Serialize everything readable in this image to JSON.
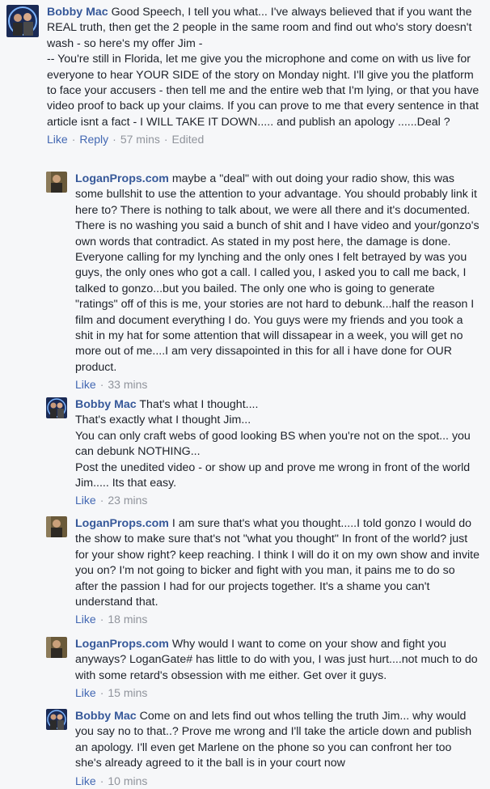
{
  "comments": [
    {
      "author": "Bobby Mac",
      "text": "Good Speech, I tell you what... I've always believed that if you want the REAL truth, then get the 2 people in the same room and find out who's story doesn't wash - so here's my offer Jim -\n-- You're still in Florida, let me give you the microphone and come on with us live for everyone to hear YOUR SIDE of the story on Monday night. I'll give you the platform to face your accusers - then tell me and the entire web that I'm lying, or that you have video proof to back up your claims. If you can prove to me that every sentence in that article isnt a fact - I WILL TAKE IT DOWN..... and publish an apology ......Deal ?",
      "like": "Like",
      "reply": "Reply",
      "time": "57 mins",
      "edited": "Edited"
    },
    {
      "author": "LoganProps.com",
      "text": "maybe a \"deal\" with out doing your radio show, this was some bullshit to use the attention to your advantage. You should probably link it here to? There is nothing to talk about, we were all there and it's documented. There is no washing you said a bunch of shit and I have video and your/gonzo's own words that contradict. As stated in my post here, the damage is done. Everyone calling for my lynching and the only ones I felt betrayed by was you guys, the only ones who got a call. I called you, I asked you to call me back, I talked to gonzo...but you bailed. The only one who is going to generate \"ratings\" off of this is me, your stories are not hard to debunk...half the reason I film and document everything I do. You guys were my friends and you took a shit in my hat for some attention that will dissapear in a week, you will get no more out of me....I am very dissapointed in this for all i have done for OUR product.",
      "like": "Like",
      "time": "33 mins"
    },
    {
      "author": "Bobby Mac",
      "text": "That's what I thought....\nThat's exactly what I thought Jim...\nYou can only craft webs of good looking BS when you're not on the spot... you can debunk NOTHING...\nPost the unedited video - or show up and prove me wrong in front of the world Jim..... Its that easy.",
      "like": "Like",
      "time": "23 mins"
    },
    {
      "author": "LoganProps.com",
      "text": "I am sure that's what you thought.....I told gonzo I would do the show to make sure that's not \"what you thought\" In front of the world? just for your show right? keep reaching. I think I will do it on my own show and invite you on? I'm not going to bicker and fight with you man, it pains me to do so after the passion I had for our projects together. It's a shame you can't understand that.",
      "like": "Like",
      "time": "18 mins"
    },
    {
      "author": "LoganProps.com",
      "text": "Why would I want to come on your show and fight you anyways? LoganGate# has little to do with you, I was just hurt....not much to do with some retard's obsession with me either. Get over it guys.",
      "like": "Like",
      "time": "15 mins"
    },
    {
      "author": "Bobby Mac",
      "text": "Come on and lets find out whos telling the truth Jim... why would you say no to that..? Prove me wrong and I'll take the article down and publish an apology. I'll even get Marlene on the phone so you can confront her too she's already agreed to it the ball is in your court now",
      "like": "Like",
      "time": "10 mins"
    }
  ],
  "colors": {
    "author": "#365899",
    "link": "#4267b2",
    "meta": "#90949c",
    "text": "#1d2129",
    "background": "#f6f7f9"
  },
  "icons": {
    "avatar_bobby": "bobby-mac-avatar",
    "avatar_logan": "loganprops-avatar"
  }
}
